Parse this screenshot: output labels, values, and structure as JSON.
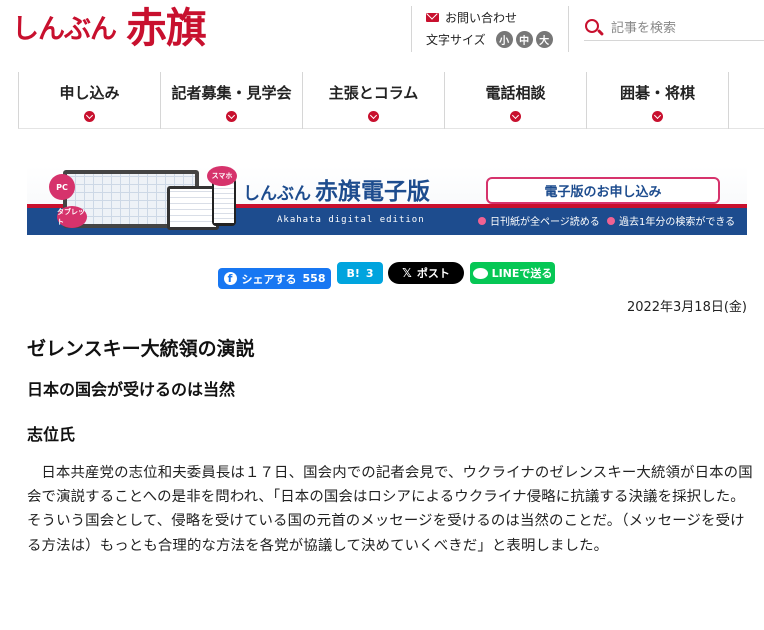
{
  "header": {
    "logo_small": "しんぶん",
    "logo_big": "赤旗",
    "contact_label": "お問い合わせ",
    "fontsize_label": "文字サイズ",
    "fontsize_options": [
      "小",
      "中",
      "大"
    ],
    "search_placeholder": "記事を検索"
  },
  "nav": {
    "items": [
      {
        "label": "申し込み"
      },
      {
        "label": "記者募集・見学会"
      },
      {
        "label": "主張とコラム"
      },
      {
        "label": "電話相談"
      },
      {
        "label": "囲碁・将棋"
      }
    ]
  },
  "banner": {
    "bubble_pc": "PC",
    "bubble_tablet": "タブレット",
    "bubble_phone": "スマホ",
    "title_small": "しんぶん",
    "title_big": "赤旗電子版",
    "subtitle": "Akahata digital edition",
    "apply_label": "電子版のお申し込み",
    "features": [
      "日刊紙が全ページ読める",
      "過去1年分の検索ができる"
    ]
  },
  "share": {
    "facebook_label": "シェアする",
    "facebook_count": "558",
    "hatena_label": "B!",
    "hatena_count": "3",
    "x_label": "ポスト",
    "line_label": "LINEで送る"
  },
  "article": {
    "date": "2022年3月18日(金)",
    "title": "ゼレンスキー大統領の演説",
    "subtitle": "日本の国会が受けるのは当然",
    "speaker": "志位氏",
    "body": "日本共産党の志位和夫委員長は１７日、国会内での記者会見で、ウクライナのゼレンスキー大統領が日本の国会で演説することへの是非を問われ、「日本の国会はロシアによるウクライナ侵略に抗議する決議を採択した。そういう国会として、侵略を受けている国の元首のメッセージを受けるのは当然のことだ。（メッセージを受ける方法は）もっとも合理的な方法を各党が協議して決めていくべきだ」と表明しました。"
  },
  "colors": {
    "brand_red": "#c8102e",
    "banner_blue": "#1d4c8e",
    "facebook": "#1877f2",
    "hatena": "#00a4de",
    "line": "#06c755"
  }
}
